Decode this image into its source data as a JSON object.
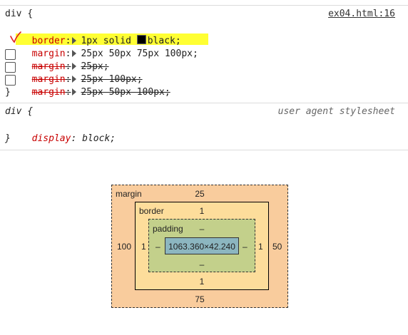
{
  "rule1": {
    "selector": "div {",
    "source": "ex04.html:16",
    "declarations": [
      {
        "property": "border",
        "value": "1px solid ",
        "color_value": "black",
        "swatch_color": "#000000",
        "overridden": false,
        "has_checkbox": false
      },
      {
        "property": "margin",
        "value": "25px 50px 75px 100px;",
        "overridden": false,
        "highlighted": true,
        "has_checkbox": false
      },
      {
        "property": "margin",
        "value": "25px;",
        "overridden": true,
        "has_checkbox": true
      },
      {
        "property": "margin",
        "value": "25px 100px;",
        "overridden": true,
        "has_checkbox": true
      },
      {
        "property": "margin",
        "value": "25px 50px 100px;",
        "overridden": true,
        "has_checkbox": true
      }
    ],
    "closing": "}"
  },
  "rule2": {
    "selector": "div {",
    "source": "user agent stylesheet",
    "property": "display",
    "value": "block;",
    "closing": "}"
  },
  "box_model": {
    "margin": {
      "label": "margin",
      "top": "25",
      "right": "50",
      "bottom": "75",
      "left": "100"
    },
    "border": {
      "label": "border",
      "top": "1",
      "right": "1",
      "bottom": "1",
      "left": "1"
    },
    "padding": {
      "label": "padding",
      "top": "–",
      "right": "–",
      "bottom": "–",
      "left": "–"
    },
    "content": "1063.360×42.240",
    "colors": {
      "margin": "#f9cc9d",
      "border": "#fddd9b",
      "padding": "#c3d08b",
      "content": "#8cb6c0",
      "highlight": "#ffff33",
      "annotation": "#e02020"
    }
  }
}
